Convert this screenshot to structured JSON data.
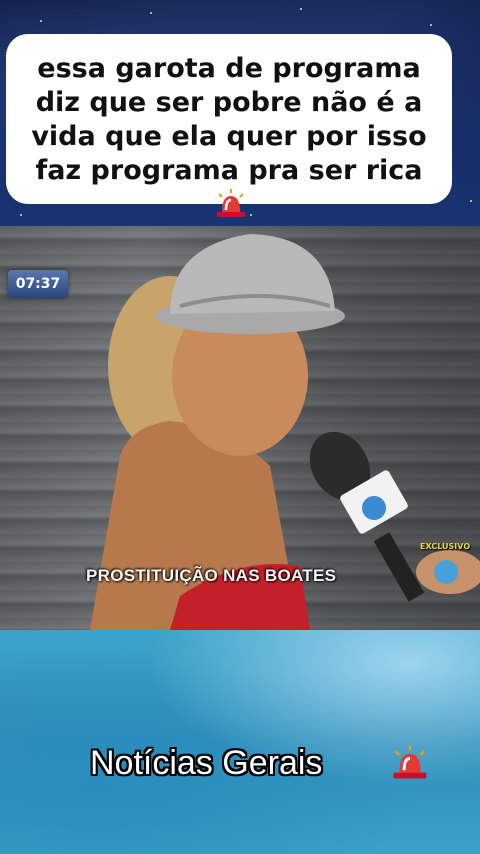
{
  "caption": {
    "text": "essa garota de programa diz que ser pobre não é a vida que ela quer por isso faz programa pra ser rica"
  },
  "tv": {
    "clock": "07:37",
    "lower_third": "PROSTITUIÇÃO NAS BOATES",
    "badge": "EXCLUSIVO"
  },
  "footer": {
    "text": "Notícias Gerais"
  },
  "icons": {
    "siren": "siren-icon"
  },
  "colors": {
    "caption_bg": "#ffffff",
    "top_sky": "#142a63",
    "bottom_sky": "#3ba3c9",
    "clock_bg": "#3b5a95"
  }
}
